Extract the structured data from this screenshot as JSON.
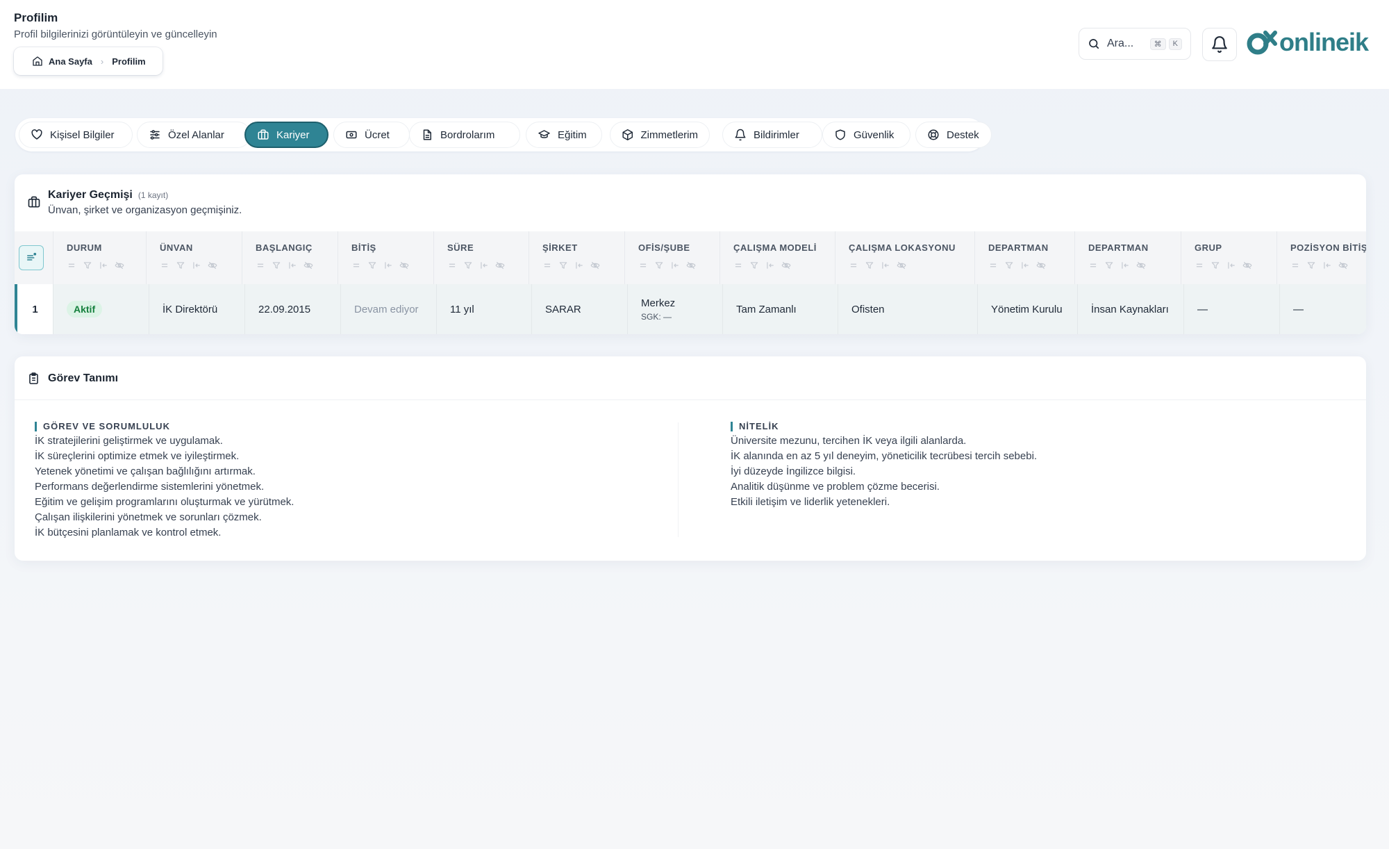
{
  "header": {
    "title": "Profilim",
    "subtitle": "Profil bilgilerinizi görüntüleyin ve güncelleyin",
    "breadcrumb": {
      "home": "Ana Sayfa",
      "current": "Profilim"
    },
    "search_placeholder": "Ara...",
    "kbd_cmd": "⌘",
    "kbd_key": "K",
    "logo_text": "onlineik"
  },
  "tabs": [
    {
      "label": "Kişisel Bilgiler",
      "icon": "heart-icon"
    },
    {
      "label": "Özel Alanlar",
      "icon": "sliders-icon"
    },
    {
      "label": "Kariyer",
      "icon": "briefcase-icon",
      "active": true
    },
    {
      "label": "Ücret",
      "icon": "banknote-icon"
    },
    {
      "label": "Bordrolarım",
      "icon": "document-icon"
    },
    {
      "label": "Eğitim",
      "icon": "graduation-cap-icon"
    },
    {
      "label": "Zimmetlerim",
      "icon": "package-icon"
    },
    {
      "label": "Bildirimler",
      "icon": "bell-icon"
    },
    {
      "label": "Güvenlik",
      "icon": "shield-icon"
    },
    {
      "label": "Destek",
      "icon": "lifebuoy-icon"
    }
  ],
  "career": {
    "title": "Kariyer Geçmişi",
    "count": "(1 kayıt)",
    "subtitle": "Ünvan, şirket ve organizasyon geçmişiniz.",
    "columns": [
      "DURUM",
      "ÜNVAN",
      "BAŞLANGIÇ",
      "BİTİŞ",
      "SÜRE",
      "ŞİRKET",
      "OFİS/ŞUBE",
      "ÇALIŞMA MODELİ",
      "ÇALIŞMA LOKASYONU",
      "DEPARTMAN",
      "DEPARTMAN",
      "GRUP",
      "POZİSYON BİTİŞ"
    ],
    "row": {
      "index": "1",
      "status": "Aktif",
      "title": "İK Direktörü",
      "start": "22.09.2015",
      "end": "Devam ediyor",
      "duration": "11 yıl",
      "company": "SARAR",
      "office": "Merkez",
      "sgk": "SGK: —",
      "work_model": "Tam Zamanlı",
      "work_location": "Ofisten",
      "department1": "Yönetim Kurulu",
      "department2": "İnsan Kaynakları",
      "group": "—",
      "position_end": "—"
    }
  },
  "job_description": {
    "title": "Görev Tanımı",
    "duties_heading": "GÖREV VE SORUMLULUK",
    "duties": [
      "İK stratejilerini geliştirmek ve uygulamak.",
      "İK süreçlerini optimize etmek ve iyileştirmek.",
      "Yetenek yönetimi ve çalışan bağlılığını artırmak.",
      "Performans değerlendirme sistemlerini yönetmek.",
      "Eğitim ve gelişim programlarını oluşturmak ve yürütmek.",
      "Çalışan ilişkilerini yönetmek ve sorunları çözmek.",
      "İK bütçesini planlamak ve kontrol etmek."
    ],
    "quals_heading": "NİTELİK",
    "quals": [
      "Üniversite mezunu, tercihen İK veya ilgili alanlarda.",
      "İK alanında en az 5 yıl deneyim, yöneticilik tecrübesi tercih sebebi.",
      "İyi düzeyde İngilizce bilgisi.",
      "Analitik düşünme ve problem çözme becerisi.",
      "Etkili iletişim ve liderlik yetenekleri."
    ]
  },
  "colors": {
    "accent": "#2f8494",
    "brand": "#2f7e88",
    "status_active": "#15803d"
  }
}
